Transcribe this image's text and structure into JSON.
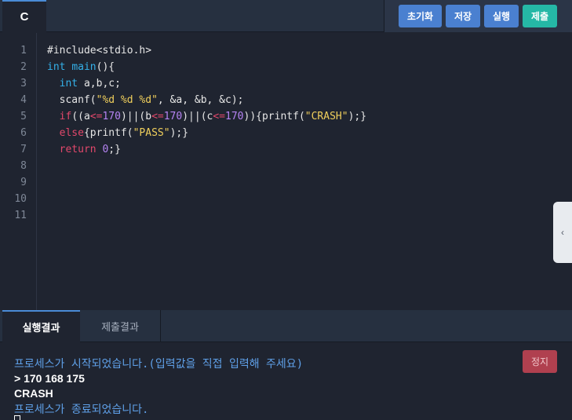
{
  "header": {
    "language_tab": "C",
    "buttons": {
      "reset": "초기화",
      "save": "저장",
      "run": "실행",
      "submit": "제출"
    }
  },
  "editor": {
    "line_numbers": [
      "1",
      "2",
      "3",
      "4",
      "5",
      "6",
      "7",
      "8",
      "9",
      "10",
      "11"
    ],
    "code": [
      "#include<stdio.h>",
      "int main(){",
      "  int a,b,c;",
      "  scanf(\"%d %d %d\", &a, &b, &c);",
      "  if((a<=170)||(b<=170)||(c<=170)){printf(\"CRASH\");}",
      "  else{printf(\"PASS\");}",
      "  return 0;}",
      "",
      "",
      "",
      ""
    ]
  },
  "side_handle": {
    "icon": "chevron-left-icon",
    "glyph": "‹"
  },
  "output": {
    "tabs": [
      "실행결과",
      "제출결과"
    ],
    "stop_label": "정지",
    "lines": [
      {
        "kind": "system",
        "text": "프로세스가 시작되었습니다.(입력값을 직접 입력해 주세요)"
      },
      {
        "kind": "user",
        "text": "> 170 168 175"
      },
      {
        "kind": "user",
        "text": "CRASH"
      },
      {
        "kind": "system",
        "text": "프로세스가 종료되었습니다."
      }
    ]
  },
  "colors": {
    "accent_blue": "#4a80d0",
    "accent_teal": "#25b8a6",
    "stop_red": "#b0404f",
    "keyword": "#e2486b",
    "type": "#34b0e8",
    "number": "#b583f2",
    "string": "#f0cf5c"
  }
}
